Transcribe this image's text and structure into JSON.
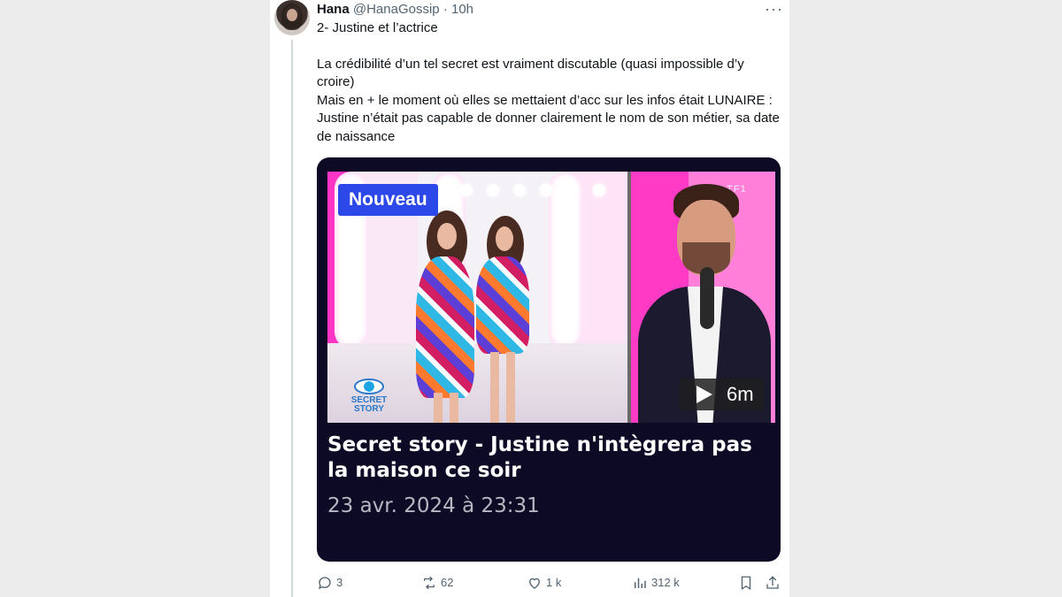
{
  "tweet": {
    "display_name": "Hana",
    "handle": "@HanaGossip",
    "separator": "·",
    "time": "10h",
    "more_label": "···",
    "lines": [
      "2- Justine et l’actrice",
      "",
      "La crédibilité d’un tel secret est vraiment discutable (quasi impossible d’y croire)",
      "Mais en + le moment où elles se mettaient d’acc sur les infos était LUNAIRE : Justine n’était pas capable de donner clairement le nom de son métier, sa date de naissance"
    ]
  },
  "card": {
    "badge": "Nouveau",
    "logo_text_1": "SECRET",
    "logo_text_2": "STORY",
    "channel_mark": "TF1",
    "duration": "6m",
    "title": "Secret story - Justine n'intègrera pas la maison ce soir",
    "date": "23 avr. 2024 à 23:31"
  },
  "actions": {
    "replies": "3",
    "reposts": "62",
    "likes": "1 k",
    "views": "312 k"
  },
  "colors": {
    "accent": "#2d48e8",
    "card_bg": "#0d0a25",
    "muted": "#536471"
  }
}
